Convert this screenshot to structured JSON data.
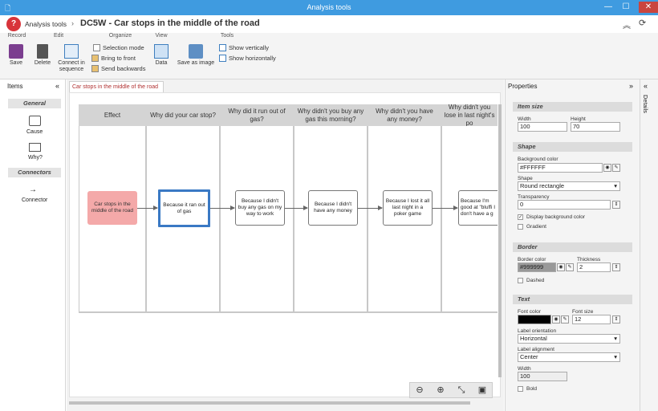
{
  "window": {
    "title": "Analysis tools",
    "minimize": "—",
    "maximize": "☐",
    "close": "✕"
  },
  "app": {
    "name": "Analysis tools",
    "breadcrumb_sep": "›",
    "doc_title": "DC5W - Car stops in the middle of the road"
  },
  "ribbon": {
    "groups": [
      "Record",
      "Edit",
      "Organize",
      "View",
      "Tools"
    ],
    "save": "Save",
    "delete": "Delete",
    "connect": "Connect in sequence",
    "selection_mode": "Selection mode",
    "bring_front": "Bring to front",
    "send_back": "Send backwards",
    "data": "Data",
    "save_image": "Save as image",
    "show_vert": "Show vertically",
    "show_horiz": "Show horizontally"
  },
  "items": {
    "header": "Items",
    "general": "General",
    "cause": "Cause",
    "why": "Why?",
    "connectors": "Connectors",
    "connector": "Connector"
  },
  "doc_tab": "Car stops in the middle of the road",
  "columns": [
    "Effect",
    "Why did your car stop?",
    "Why did it run out of gas?",
    "Why didn't you buy any gas this morning?",
    "Why didn't you have any money?",
    "Why didn't you lose in last night's po"
  ],
  "nodes": [
    "Car stops in the middle of the road",
    "Because it ran out of gas",
    "Because I didn't buy any gas on my way to work",
    "Because I didn't have any money",
    "Because I lost it all last night in a poker game",
    "Because I'm good at \"bluffi I don't have a g"
  ],
  "props": {
    "header": "Properties",
    "details_tab": "Details",
    "item_size": "Item size",
    "width_lbl": "Width",
    "width": "100",
    "height_lbl": "Height",
    "height": "70",
    "shape_sec": "Shape",
    "bg_color_lbl": "Background color",
    "bg_color": "#FFFFFF",
    "shape_lbl": "Shape",
    "shape": "Round rectangle",
    "transparency_lbl": "Transparency",
    "transparency": "0",
    "display_bg": "Display background color",
    "gradient": "Gradient",
    "border_sec": "Border",
    "border_color_lbl": "Border color",
    "border_color": "#999999",
    "thickness_lbl": "Thickness",
    "thickness": "2",
    "dashed": "Dashed",
    "text_sec": "Text",
    "font_color_lbl": "Font color",
    "font_size_lbl": "Font size",
    "font_size": "12",
    "label_orient_lbl": "Label orientation",
    "label_orient": "Horizontal",
    "label_align_lbl": "Label alignment",
    "label_align": "Center",
    "width2_lbl": "Width",
    "width2": "100",
    "bold": "Bold"
  },
  "colors": {
    "titlebar": "#3f9be0",
    "effect_node": "#f4a9a9",
    "selected_border": "#3a79c4"
  }
}
